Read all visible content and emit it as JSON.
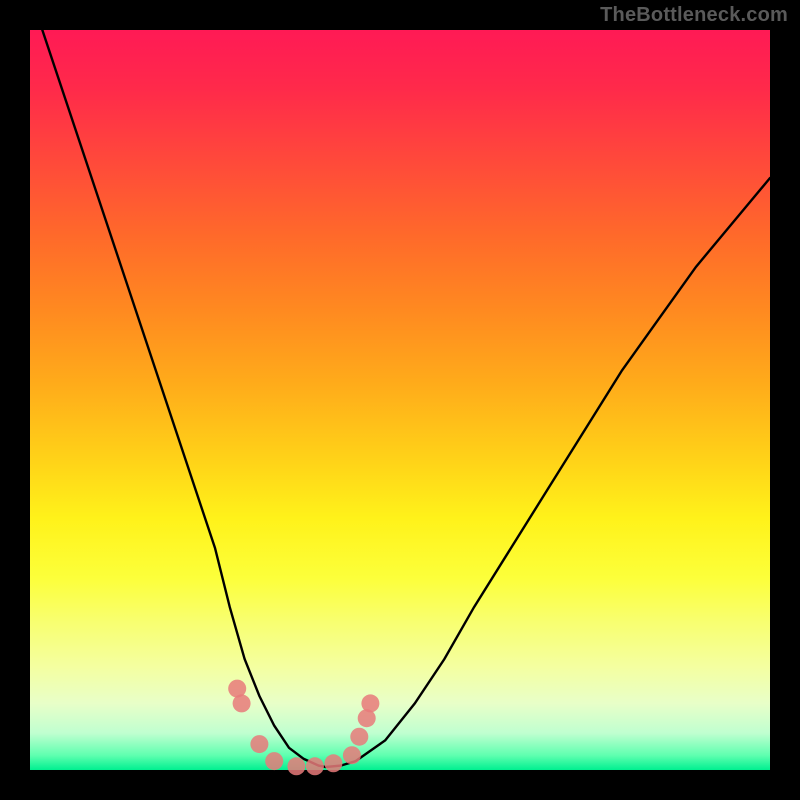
{
  "watermark": "TheBottleneck.com",
  "colors": {
    "background": "#000000",
    "gradient_top": "#ff1a55",
    "gradient_bottom": "#00f090",
    "curve": "#000000",
    "dots": "#e77a7a"
  },
  "chart_data": {
    "type": "line",
    "title": "",
    "xlabel": "",
    "ylabel": "",
    "xlim": [
      0,
      100
    ],
    "ylim": [
      0,
      100
    ],
    "grid": false,
    "legend": false,
    "series": [
      {
        "name": "curve",
        "x": [
          0,
          5,
          10,
          15,
          20,
          25,
          27,
          29,
          31,
          33,
          35,
          37,
          39,
          40,
          42,
          44,
          48,
          52,
          56,
          60,
          65,
          70,
          75,
          80,
          85,
          90,
          95,
          100
        ],
        "values": [
          105,
          90,
          75,
          60,
          45,
          30,
          22,
          15,
          10,
          6,
          3,
          1.5,
          0.6,
          0.4,
          0.6,
          1.2,
          4,
          9,
          15,
          22,
          30,
          38,
          46,
          54,
          61,
          68,
          74,
          80
        ]
      }
    ],
    "markers": [
      {
        "x": 28,
        "y": 11
      },
      {
        "x": 28.6,
        "y": 9
      },
      {
        "x": 31,
        "y": 3.5
      },
      {
        "x": 33,
        "y": 1.2
      },
      {
        "x": 36,
        "y": 0.5
      },
      {
        "x": 38.5,
        "y": 0.5
      },
      {
        "x": 41,
        "y": 0.9
      },
      {
        "x": 43.5,
        "y": 2
      },
      {
        "x": 44.5,
        "y": 4.5
      },
      {
        "x": 45.5,
        "y": 7
      },
      {
        "x": 46,
        "y": 9
      }
    ]
  }
}
